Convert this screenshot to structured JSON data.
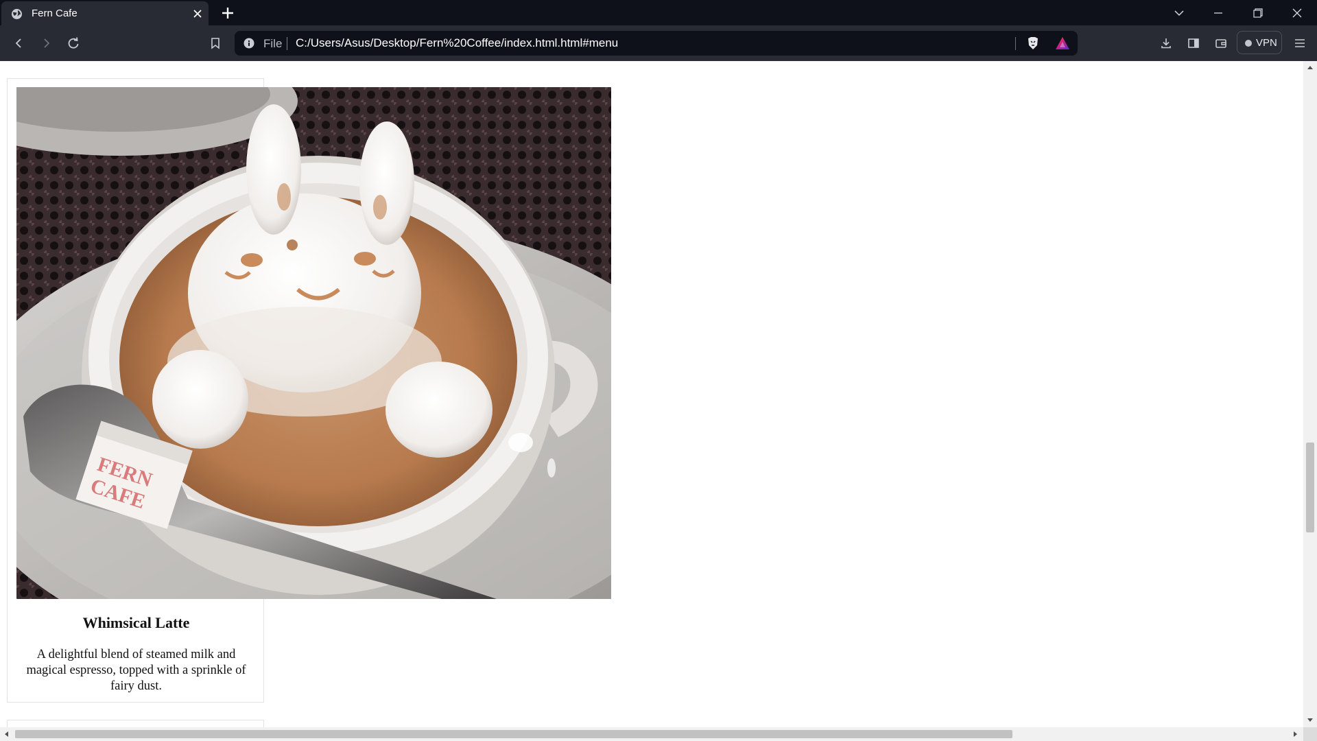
{
  "browser": {
    "tab": {
      "title": "Fern Cafe"
    },
    "address_bar": {
      "scheme_label": "File",
      "url": "C:/Users/Asus/Desktop/Fern%20Coffee/index.html.html#menu"
    },
    "vpn_label": "VPN",
    "icons": {
      "tab_favicon": "globe-icon",
      "tab_close": "close-icon",
      "new_tab": "plus-icon",
      "tab_list": "chevron-down-icon",
      "minimize": "minimize-icon",
      "restore": "restore-icon",
      "close_window": "close-icon",
      "back": "back-arrow-icon",
      "forward": "forward-arrow-icon",
      "reload": "reload-icon",
      "bookmark": "bookmark-icon",
      "site_info": "info-icon",
      "brave_shields": "lion-shield-icon",
      "brave_rewards": "triangle-rewards-icon",
      "downloads": "download-icon",
      "sidebar": "sidebar-icon",
      "wallet": "wallet-icon",
      "menu": "hamburger-menu-icon"
    }
  },
  "page": {
    "menu_item": {
      "image_alt": "latte-art-bunny-photo",
      "sugar_cube_text": "FERN CAFE",
      "name": "Whimsical Latte",
      "description": "A delightful blend of steamed milk and magical espresso, topped with a sprinkle of fairy dust."
    }
  },
  "colors": {
    "tab_strip": "#0e111a",
    "toolbar": "#282b33",
    "omnibox": "#0e111a",
    "page_bg": "#ffffff",
    "card_border": "#e2e2e2"
  }
}
